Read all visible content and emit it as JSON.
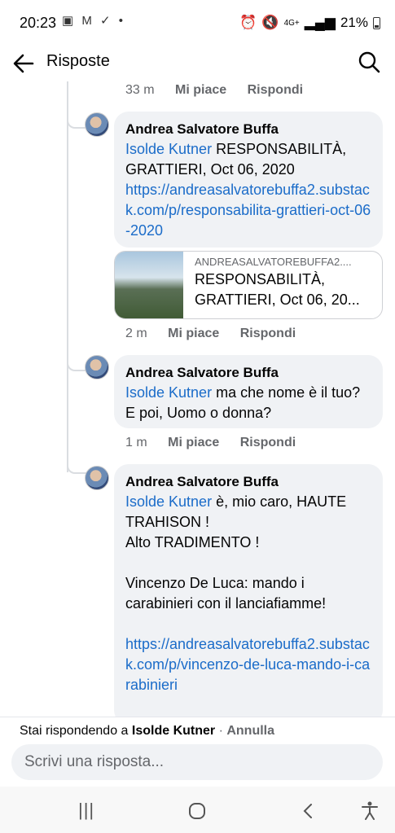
{
  "status": {
    "time": "20:23",
    "left_icons": "▣ M ✓ •",
    "network": "4G+",
    "battery": "21%"
  },
  "header": {
    "title": "Risposte"
  },
  "comments": [
    {
      "time": "33 m",
      "like": "Mi piace",
      "reply": "Rispondi"
    },
    {
      "author": "Andrea Salvatore Buffa",
      "mention": "Isolde Kutner",
      "text": "RESPONSABILITÀ, GRATTIERI, Oct 06, 2020",
      "link": "https://andreasalvatorebuffa2.substack.com/p/responsabilita-grattieri-oct-06-2020",
      "preview": {
        "domain": "ANDREASALVATOREBUFFA2....",
        "title": "RESPONSABILITÀ, GRATTIERI, Oct 06, 20..."
      },
      "time": "2 m",
      "like": "Mi piace",
      "reply": "Rispondi"
    },
    {
      "author": "Andrea Salvatore Buffa",
      "mention": "Isolde Kutner",
      "text": "ma che nome è il tuo? E poi, Uomo o donna?",
      "time": "1 m",
      "like": "Mi piace",
      "reply": "Rispondi"
    },
    {
      "author": "Andrea Salvatore Buffa",
      "mention": "Isolde Kutner",
      "text": "è, mio caro, HAUTE TRAHISON !\nAlto TRADIMENTO !\n\nVincenzo De Luca: mando i carabinieri con il lanciafiamme!",
      "link": "https://andreasalvatorebuffa2.substack.com/p/vincenzo-de-luca-mando-i-carabinieri"
    }
  ],
  "reply_bar": {
    "prefix": "Stai rispondendo a",
    "name": "Isolde Kutner",
    "separator": " · ",
    "cancel": "Annulla",
    "placeholder": "Scrivi una risposta..."
  },
  "nav": {
    "recents": "|||",
    "home": "○",
    "back": "‹",
    "accessibility": "♿"
  },
  "colors": {
    "link": "#1b6cc9",
    "bubble": "#f0f2f5",
    "secondary_text": "#65676b"
  }
}
